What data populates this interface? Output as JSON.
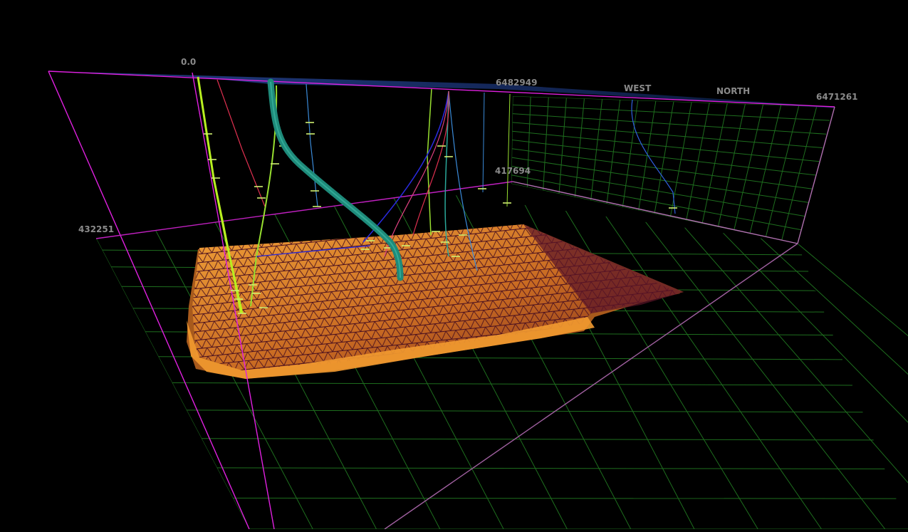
{
  "scene": {
    "colors": {
      "background": "#000000",
      "bounding_box": "#e020e0",
      "grid": "#1e6e1e",
      "surface_fill": "#e08a2c",
      "surface_mesh": "#5a1428",
      "label": "#8a8a8a"
    },
    "labels": {
      "depth_top": "0.0",
      "northing_top": "6482949",
      "direction_west": "WEST",
      "direction_north": "NORTH",
      "northing_right": "6471261",
      "easting_mid": "417694",
      "easting_left": "432251"
    },
    "well_colors": [
      "#b8f020",
      "#e03050",
      "#2aa89a",
      "#3a8ad8",
      "#2a2ae0",
      "#e04080",
      "#98e030",
      "#3060e0"
    ]
  }
}
